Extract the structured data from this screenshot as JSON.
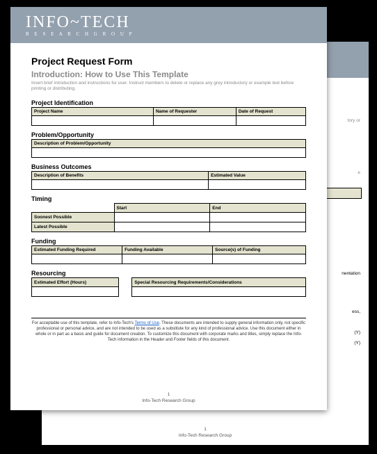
{
  "brand": {
    "name": "INFO~TECH",
    "tagline": "R E S E A R C H   G R O U P"
  },
  "doc": {
    "title": "Project Request Form",
    "subtitle": "Introduction: How to Use This Template",
    "instructions": "Insert brief introduction and instructions for user. Instruct members to delete or replace any grey introductory or example text before printing or distributing."
  },
  "sections": {
    "identification": {
      "heading": "Project Identification",
      "cols": [
        "Project Name",
        "Name of Requester",
        "Date of Request"
      ]
    },
    "problem": {
      "heading": "Problem/Opportunity",
      "cols": [
        "Description of Problem/Opportunity"
      ]
    },
    "outcomes": {
      "heading": "Business Outcomes",
      "cols": [
        "Description of Benefits",
        "Estimated Value"
      ]
    },
    "timing": {
      "heading": "Timing",
      "cols": [
        "",
        "Start",
        "End"
      ],
      "rows": [
        "Soonest Possible",
        "Latest Possible"
      ]
    },
    "funding": {
      "heading": "Funding",
      "cols": [
        "Estimated Funding Required",
        "Funding Available",
        "Source(s) of Funding"
      ]
    },
    "resourcing": {
      "heading": "Resourcing",
      "cols": [
        "Estimated Effort (Hours)",
        "Special Resourcing Requirements/Considerations"
      ]
    }
  },
  "disclaimer": {
    "prefix": "For acceptable use of this template, refer to Info-Tech's ",
    "link": "Terms of Use",
    "suffix": ". These documents are intended to supply general information only, not specific professional or personal advice, and are not intended to be used as a substitute for any kind of professional advice. Use this document either in whole or in part as a basis and guide for document creation. To customize this document with corporate marks and titles, simply replace the Info-Tech information in the Header and Footer fields of this document."
  },
  "footer": {
    "page": "1",
    "org": "Info-Tech Research Group"
  },
  "back_fragments": {
    "f1": "tory or",
    "f2": "e",
    "f3": "nentation",
    "f4": "ess,",
    "f5": "(Y)",
    "f6": "(Y)"
  }
}
